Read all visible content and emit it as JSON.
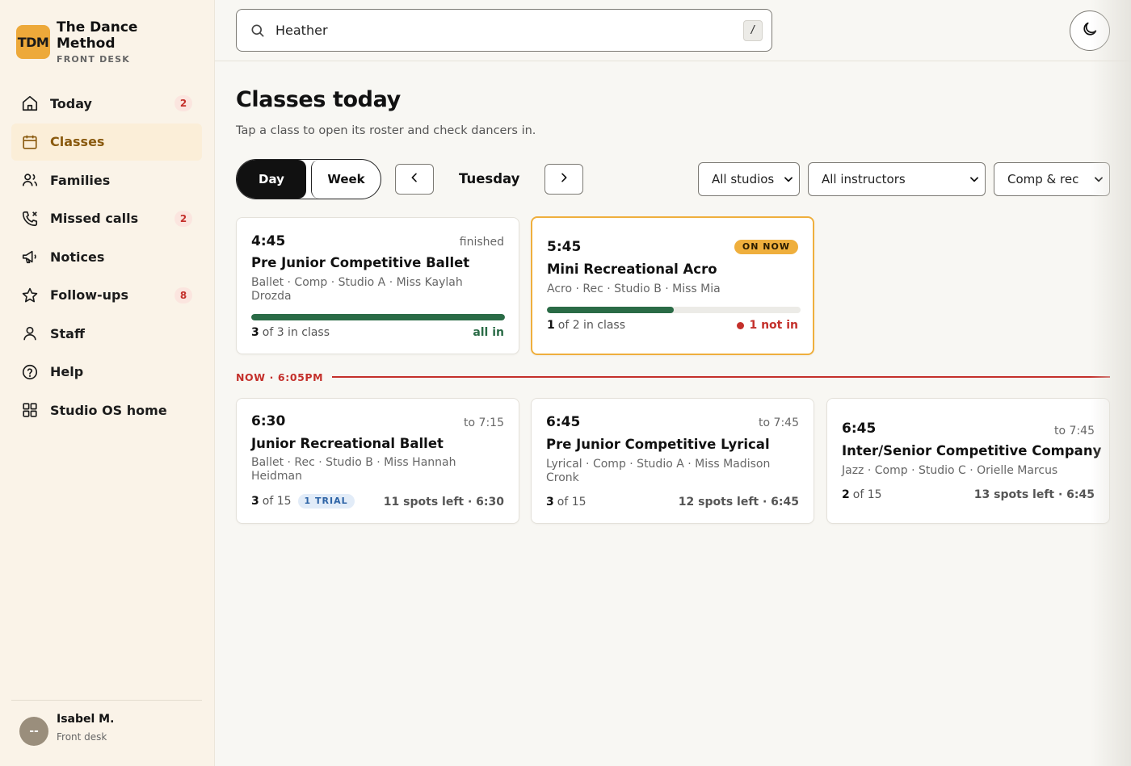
{
  "brand": {
    "logo": "TDM",
    "name": "The Dance Method",
    "sub": "FRONT DESK"
  },
  "nav": [
    {
      "label": "Today",
      "icon": "home-icon",
      "badge": "2"
    },
    {
      "label": "Classes",
      "icon": "calendar-icon",
      "active": true
    },
    {
      "label": "Families",
      "icon": "families-icon"
    },
    {
      "label": "Missed calls",
      "icon": "missed-call-icon",
      "badge": "2"
    },
    {
      "label": "Notices",
      "icon": "megaphone-icon"
    },
    {
      "label": "Follow-ups",
      "icon": "star-icon",
      "badge": "8"
    },
    {
      "label": "Staff",
      "icon": "person-icon"
    },
    {
      "label": "Help",
      "icon": "help-icon"
    },
    {
      "label": "Studio OS home",
      "icon": "grid-icon"
    }
  ],
  "user": {
    "initials": "--",
    "name": "Isabel M.",
    "role": "Front desk"
  },
  "search": {
    "value": "Heather",
    "shortcut": "/"
  },
  "page": {
    "title": "Classes today",
    "subtitle": "Tap a class to open its roster and check dancers in."
  },
  "view": {
    "day": "Day",
    "week": "Week",
    "selected": "Day",
    "current_day": "Tuesday"
  },
  "filters": {
    "studio": "All studios",
    "instructor": "All instructors",
    "level": "Comp & rec"
  },
  "now_marker": "NOW · 6:05PM",
  "classes_before": [
    {
      "time": "4:45",
      "status": "finished",
      "name": "Pre Junior Competitive Ballet",
      "details": "Ballet · Comp · Studio A · Miss Kaylah Drozda",
      "in_count": "3",
      "of_text": "of 3 in class",
      "progress": 1.0,
      "result": "all in"
    },
    {
      "time": "5:45",
      "status": "ON NOW",
      "name": "Mini Recreational Acro",
      "details": "Acro · Rec · Studio B · Miss Mia",
      "in_count": "1",
      "of_text": "of 2 in class",
      "progress": 0.5,
      "result": "1 not in"
    }
  ],
  "classes_after": [
    {
      "time": "6:30",
      "end": "to 7:15",
      "name": "Junior Recreational Ballet",
      "details": "Ballet · Rec · Studio B · Miss Hannah Heidman",
      "count": "3",
      "of_text": "of 15",
      "trial": "1 TRIAL",
      "spots": "11 spots left · 6:30"
    },
    {
      "time": "6:45",
      "end": "to 7:45",
      "name": "Pre Junior Competitive Lyrical",
      "details": "Lyrical · Comp · Studio A · Miss Madison Cronk",
      "count": "3",
      "of_text": "of 15",
      "spots": "12 spots left · 6:45"
    },
    {
      "time": "6:45",
      "end": "to 7:45",
      "name": "Inter/Senior Competitive Company",
      "details": "Jazz · Comp · Studio C · Orielle Marcus",
      "count": "2",
      "of_text": "of 15",
      "spots": "13 spots left · 6:45"
    }
  ],
  "colors": {
    "accent": "#efaf3d",
    "active_text": "#8a5a0f",
    "success": "#2a6b46",
    "danger": "#c4302b",
    "trial": "#2e64a6"
  }
}
